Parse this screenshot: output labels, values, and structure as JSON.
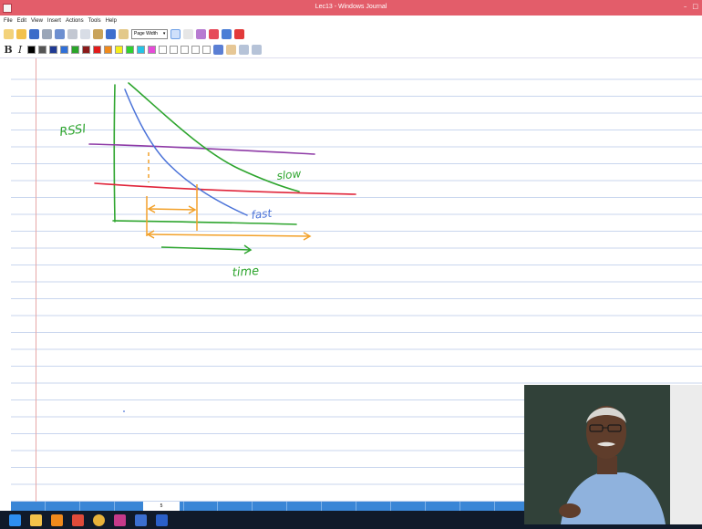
{
  "window": {
    "title": "Lec13 - Windows Journal",
    "min_label": "–",
    "max_label": "□"
  },
  "menu": {
    "items": [
      "File",
      "Edit",
      "View",
      "Insert",
      "Actions",
      "Tools",
      "Help"
    ]
  },
  "toolbar": {
    "page_width_label": "Page Width"
  },
  "format": {
    "bold_label": "B",
    "italic_label": "I"
  },
  "swatches": [
    "#000000",
    "#555555",
    "#1f3a93",
    "#2f6fd8",
    "#2aa52a",
    "#8b1a1a",
    "#e21b1b",
    "#f08a1c",
    "#f6ee1a",
    "#2fd22f",
    "#25c3e6",
    "#e64bd8",
    "#ffffff",
    "#ffffff",
    "#ffffff",
    "#ffffff",
    "#ffffff"
  ],
  "notes": {
    "rssi_label": "RSSI",
    "slow_label": "slow",
    "fast_label": "fast",
    "time_label": "time"
  },
  "pagebar": {
    "current_page": "5"
  },
  "colors": {
    "purple": "#8e3aa6",
    "green": "#2ea52e",
    "red": "#e0243a",
    "blue": "#4a72d8",
    "orange": "#f2a12a"
  }
}
